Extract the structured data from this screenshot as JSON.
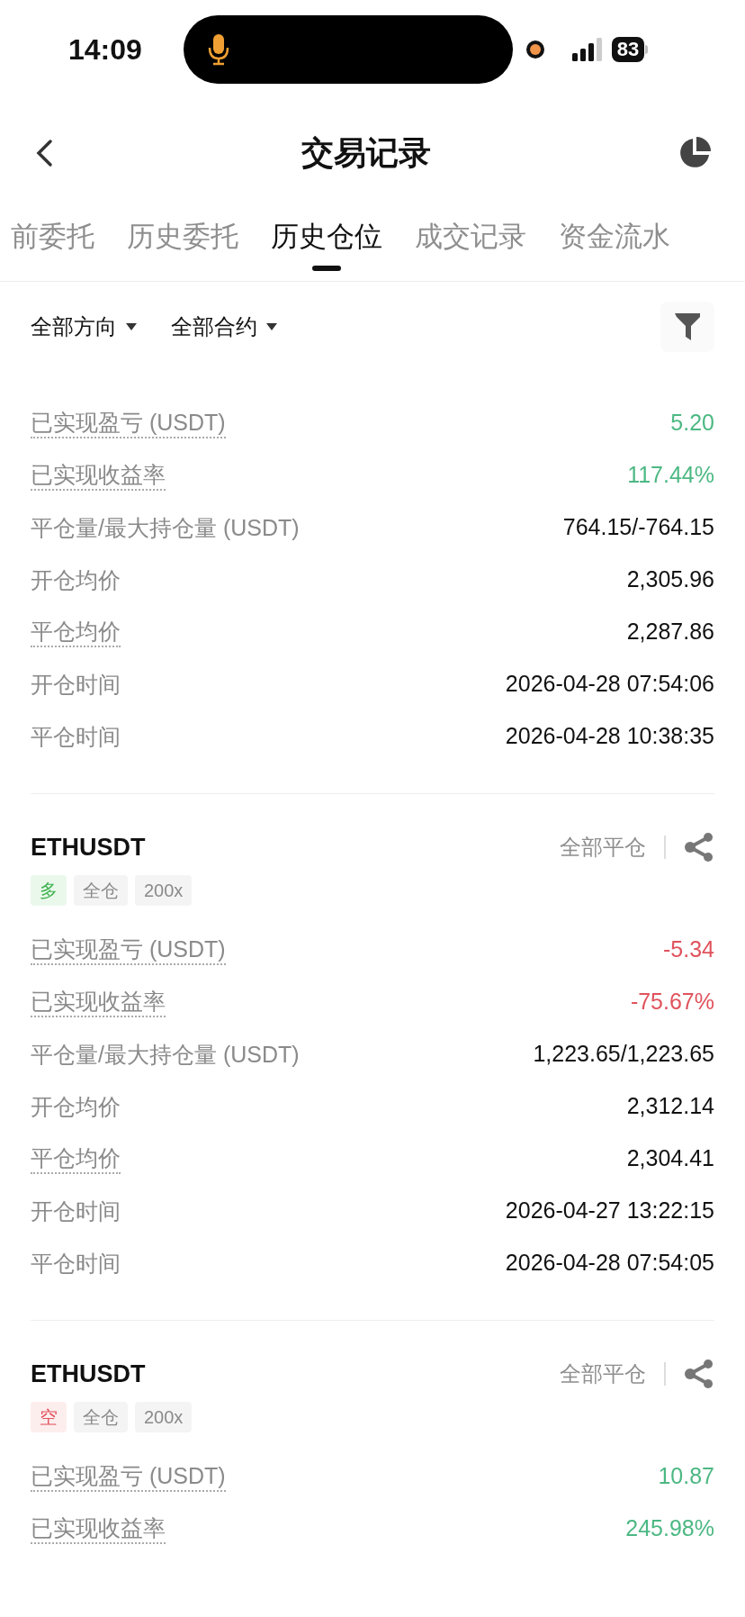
{
  "status_bar": {
    "time": "14:09",
    "battery": "83"
  },
  "header": {
    "title": "交易记录"
  },
  "tabs": [
    {
      "label": "前委托",
      "selected": false
    },
    {
      "label": "历史委托",
      "selected": false
    },
    {
      "label": "历史仓位",
      "selected": true
    },
    {
      "label": "成交记录",
      "selected": false
    },
    {
      "label": "资金流水",
      "selected": false
    }
  ],
  "filters": [
    {
      "label": "全部方向"
    },
    {
      "label": "全部合约"
    }
  ],
  "positions": [
    {
      "rows": [
        {
          "label": "已实现盈亏 (USDT)",
          "value": "5.20",
          "color": "#4cb883",
          "dotted": true
        },
        {
          "label": "已实现收益率",
          "value": "117.44%",
          "color": "#4cb883",
          "dotted": true
        },
        {
          "label": "平仓量/最大持仓量 (USDT)",
          "value": "764.15/-764.15",
          "color": "#111111",
          "dotted": false
        },
        {
          "label": "开仓均价",
          "value": "2,305.96",
          "color": "#111111",
          "dotted": false
        },
        {
          "label": "平仓均价",
          "value": "2,287.86",
          "color": "#111111",
          "dotted": true
        },
        {
          "label": "开仓时间",
          "value": "2026-04-28 07:54:06",
          "color": "#111111",
          "dotted": false
        },
        {
          "label": "平仓时间",
          "value": "2026-04-28 10:38:35",
          "color": "#111111",
          "dotted": false
        }
      ]
    },
    {
      "symbol": "ETHUSDT",
      "close_type": "全部平仓",
      "tags": [
        {
          "text": "多",
          "kind": "long"
        },
        {
          "text": "全仓",
          "kind": "neutral"
        },
        {
          "text": "200x",
          "kind": "neutral"
        }
      ],
      "rows": [
        {
          "label": "已实现盈亏 (USDT)",
          "value": "-5.34",
          "color": "#e0525c",
          "dotted": true
        },
        {
          "label": "已实现收益率",
          "value": "-75.67%",
          "color": "#e0525c",
          "dotted": true
        },
        {
          "label": "平仓量/最大持仓量 (USDT)",
          "value": "1,223.65/1,223.65",
          "color": "#111111",
          "dotted": false
        },
        {
          "label": "开仓均价",
          "value": "2,312.14",
          "color": "#111111",
          "dotted": false
        },
        {
          "label": "平仓均价",
          "value": "2,304.41",
          "color": "#111111",
          "dotted": true
        },
        {
          "label": "开仓时间",
          "value": "2026-04-27 13:22:15",
          "color": "#111111",
          "dotted": false
        },
        {
          "label": "平仓时间",
          "value": "2026-04-28 07:54:05",
          "color": "#111111",
          "dotted": false
        }
      ]
    },
    {
      "symbol": "ETHUSDT",
      "close_type": "全部平仓",
      "tags": [
        {
          "text": "空",
          "kind": "short"
        },
        {
          "text": "全仓",
          "kind": "neutral"
        },
        {
          "text": "200x",
          "kind": "neutral"
        }
      ],
      "rows": [
        {
          "label": "已实现盈亏 (USDT)",
          "value": "10.87",
          "color": "#4cb883",
          "dotted": true
        },
        {
          "label": "已实现收益率",
          "value": "245.98%",
          "color": "#4cb883",
          "dotted": true
        }
      ]
    }
  ]
}
